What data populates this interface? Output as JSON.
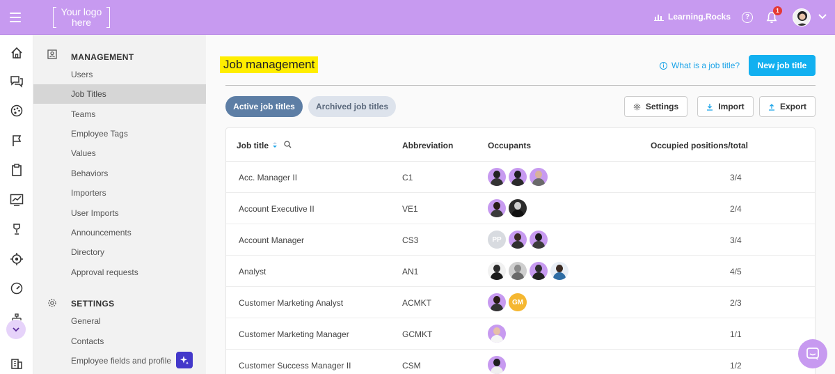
{
  "topbar": {
    "logo_line1": "Your logo",
    "logo_line2": "here",
    "brand": "Learning.Rocks",
    "help_glyph": "?",
    "notification_count": "1",
    "background": "#c79af0"
  },
  "rail_icons": [
    "home-icon",
    "chat-icon",
    "palette-icon",
    "flag-icon",
    "clipboard-icon",
    "chart-icon",
    "trophy-icon",
    "target-icon",
    "gauge-icon",
    "org-chart-icon",
    "building-icon"
  ],
  "submenu": {
    "management_header": "MANAGEMENT",
    "management_items": [
      "Users",
      "Job Titles",
      "Teams",
      "Employee Tags",
      "Values",
      "Behaviors",
      "Importers",
      "User Imports",
      "Announcements",
      "Directory",
      "Approval requests"
    ],
    "active_item": "Job Titles",
    "settings_header": "SETTINGS",
    "settings_items": [
      "General",
      "Contacts",
      "Employee fields and profile"
    ]
  },
  "main": {
    "title": "Job management",
    "help_link": "What is a job title?",
    "new_button": "New job title",
    "tabs": {
      "active": "Active job titles",
      "archived": "Archived job titles"
    },
    "buttons": {
      "settings": "Settings",
      "import": "Import",
      "export": "Export"
    },
    "columns": {
      "title": "Job title",
      "abbreviation": "Abbreviation",
      "occupants": "Occupants",
      "positions": "Occupied positions/total"
    },
    "rows": [
      {
        "title": "Acc. Manager II",
        "abbr": "C1",
        "positions": "3/4"
      },
      {
        "title": "Account Executive II",
        "abbr": "VE1",
        "positions": "2/4"
      },
      {
        "title": "Account Manager",
        "abbr": "CS3",
        "positions": "3/4"
      },
      {
        "title": "Analyst",
        "abbr": "AN1",
        "positions": "4/5"
      },
      {
        "title": "Customer Marketing Analyst",
        "abbr": "ACMKT",
        "positions": "2/3"
      },
      {
        "title": "Customer Marketing Manager",
        "abbr": "GCMKT",
        "positions": "1/1"
      },
      {
        "title": "Customer Success Manager II",
        "abbr": "CSM",
        "positions": "1/2"
      }
    ],
    "initials": {
      "pp": "PP",
      "gm": "GM"
    }
  },
  "colors": {
    "accent": "#12b0f0",
    "brand_purple": "#c79af0",
    "highlight": "#ffee00",
    "tab_active": "#5d7ea5"
  }
}
